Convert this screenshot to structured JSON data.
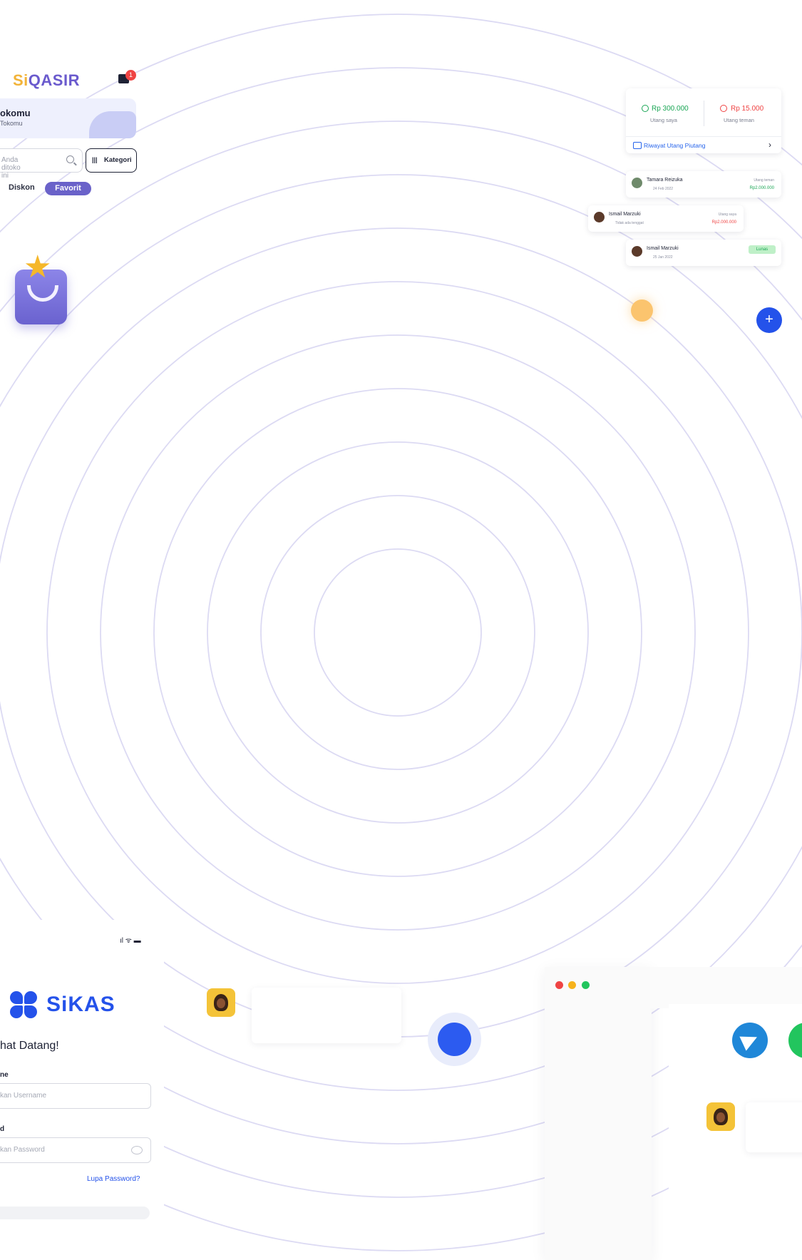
{
  "siqasir": {
    "logo_a": "Si",
    "logo_b": "QASIR",
    "cart_badge": "1",
    "store_name": "okomu",
    "store_sub": "Tokomu",
    "search_placeholder": "Anda ditoko ini",
    "kategori_icon": "|||",
    "kategori_label": "Kategori",
    "tab_diskon": "Diskon",
    "tab_favorit": "Favorit"
  },
  "debt": {
    "amount_mine": "Rp 300.000",
    "label_mine": "Utang saya",
    "amount_friend": "Rp 15.000",
    "label_friend": "Utang teman",
    "history_label": "Riwayat Utang Piutang",
    "history_chevron": "›",
    "entries": [
      {
        "name": "Tamara Reizuka",
        "date": "24 Feb 2022",
        "label": "Utang teman",
        "amount": "Rp2.000.000",
        "amount_color": "#1aa655"
      },
      {
        "name": "Ismail Marzuki",
        "date": "Tidak ada tenggat",
        "label": "Utang saya",
        "amount": "Rp2.000.000",
        "amount_color": "#ef4444"
      },
      {
        "name": "Ismail Marzuki",
        "date": "25 Jan 2022",
        "status": "Lunas"
      }
    ],
    "fab_label": "+"
  },
  "sikas": {
    "status_icons": "ıl ᯤ ▬",
    "brand": "SiKAS",
    "welcome": "hat Datang!",
    "username_label": "ne",
    "username_placeholder": "kan Username",
    "password_label": "d",
    "password_placeholder": "kan Password",
    "forgot": "Lupa Password?"
  },
  "colors": {
    "brand_blue": "#2452ea",
    "siqasir_purple": "#6a62c9",
    "siqasir_yellow": "#f2b338",
    "ring": "#dcdaf3"
  },
  "icons": [
    "cart-icon",
    "search-icon",
    "filter-icon",
    "shopping-bag-icon",
    "star-icon",
    "plus-icon",
    "telegram-icon",
    "whatsapp-icon",
    "eye-icon"
  ]
}
